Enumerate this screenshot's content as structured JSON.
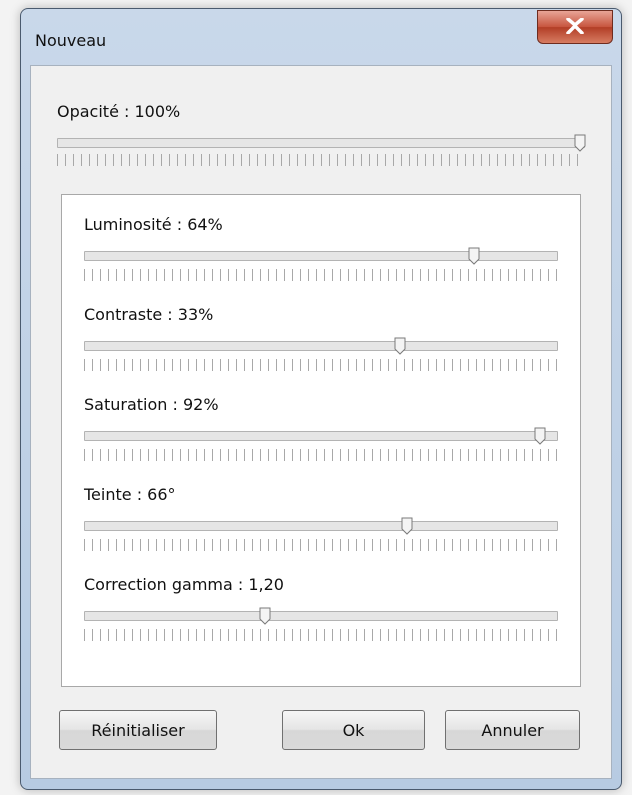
{
  "window": {
    "title": "Nouveau"
  },
  "opacity": {
    "label": "Opacité : 100%",
    "value_fraction": 1.0
  },
  "adjustments": [
    {
      "label": "Luminosité : 64%",
      "value_fraction": 0.82
    },
    {
      "label": "Contraste : 33%",
      "value_fraction": 0.665
    },
    {
      "label": "Saturation : 92%",
      "value_fraction": 0.96
    },
    {
      "label": "Teinte : 66°",
      "value_fraction": 0.68
    },
    {
      "label": "Correction gamma : 1,20",
      "value_fraction": 0.38
    }
  ],
  "buttons": {
    "reset": "Réinitialiser",
    "ok": "Ok",
    "cancel": "Annuler"
  },
  "icons": {
    "close": "close-x-icon",
    "slider_thumb": "slider-thumb-icon"
  },
  "colors": {
    "close_button": "#c7553e",
    "frame": "#b7cbe2"
  }
}
